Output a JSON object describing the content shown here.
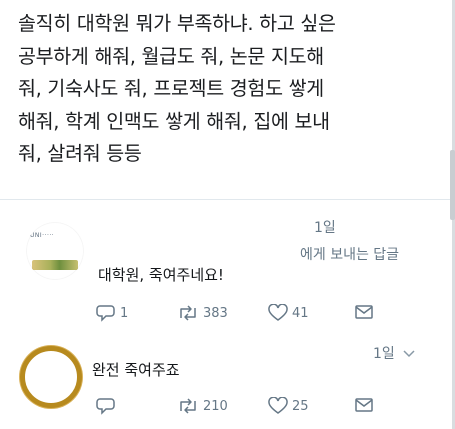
{
  "main_tweet": {
    "lines": [
      "솔직히 대학원 뭐가 부족하냐. 하고 싶은",
      "공부하게 해줘, 월급도 줘, 논문 지도해",
      "줘, 기숙사도 줘, 프로젝트 경험도 쌓게",
      "해줘, 학계 인맥도 쌓게 해줘, 집에 보내",
      "줘, 살려줘 등등"
    ]
  },
  "replies": [
    {
      "avatar_logo_text": "UNI·····",
      "time": "1일",
      "sub_label": "에게 보내는 답글",
      "text": "대학원, 죽여주네요!",
      "reply_count": "1",
      "retweet_count": "383",
      "like_count": "41"
    },
    {
      "time": "1일",
      "text": "완전 죽여주죠",
      "reply_count": "",
      "retweet_count": "210",
      "like_count": "25"
    }
  ],
  "icons": {
    "reply": "reply-icon",
    "retweet": "retweet-icon",
    "like": "heart-icon",
    "dm": "envelope-icon",
    "more": "chevron-down-icon"
  },
  "colors": {
    "text": "#14171a",
    "muted": "#657786",
    "divider": "#e1e8ed",
    "avatar_ring": "#b78a1e"
  }
}
